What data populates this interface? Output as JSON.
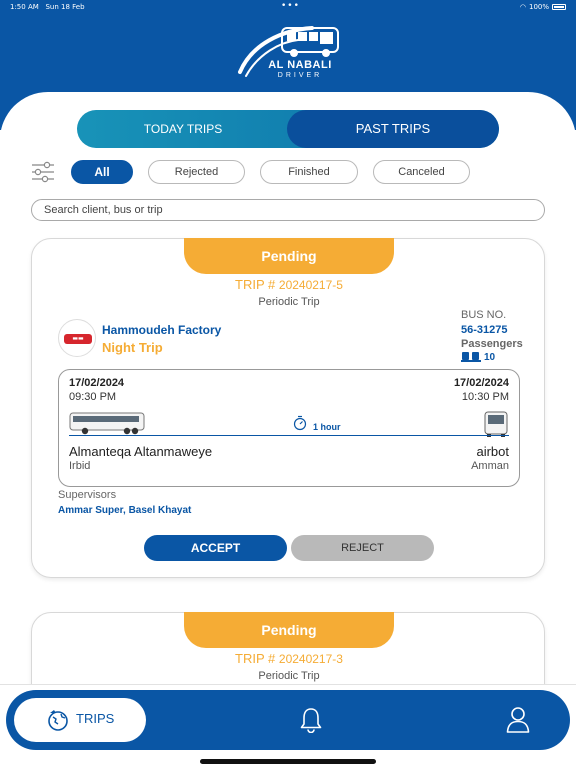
{
  "status_bar": {
    "time": "1:50 AM",
    "date": "Sun 18 Feb",
    "battery": "100%"
  },
  "brand": {
    "name": "AL NABALI",
    "subtitle": "DRIVER"
  },
  "tabs": {
    "today": "TODAY TRIPS",
    "past": "PAST TRIPS",
    "active": "past"
  },
  "filters": [
    {
      "label": "All",
      "active": true
    },
    {
      "label": "Rejected",
      "active": false
    },
    {
      "label": "Finished",
      "active": false
    },
    {
      "label": "Canceled",
      "active": false
    }
  ],
  "search": {
    "placeholder": "Search client, bus or trip"
  },
  "trips": [
    {
      "status": "Pending",
      "trip_prefix": "TRIP #",
      "trip_number": "20240217-5",
      "trip_type": "Periodic Trip",
      "client": {
        "name": "Hammoudeh Factory",
        "shift": "Night Trip"
      },
      "bus_label": "BUS NO.",
      "bus_number": "56-31275",
      "passengers_label": "Passengers",
      "passengers": "10",
      "departure": {
        "date": "17/02/2024",
        "time": "09:30 PM",
        "place": "Almanteqa Altanmaweye",
        "city": "Irbid"
      },
      "arrival": {
        "date": "17/02/2024",
        "time": "10:30 PM",
        "place": "airbot",
        "city": "Amman"
      },
      "duration": "1 hour",
      "supervisors_label": "Supervisors",
      "supervisors": "Ammar Super, Basel Khayat",
      "accept_label": "ACCEPT",
      "reject_label": "REJECT"
    },
    {
      "status": "Pending",
      "trip_prefix": "TRIP #",
      "trip_number": "20240217-3",
      "trip_type": "Periodic Trip"
    }
  ],
  "bottom_nav": {
    "trips_label": "TRIPS"
  },
  "colors": {
    "primary": "#0a56a5",
    "accent": "#f5ac35",
    "teal": "#1893b8",
    "muted": "#b9b9b9"
  }
}
